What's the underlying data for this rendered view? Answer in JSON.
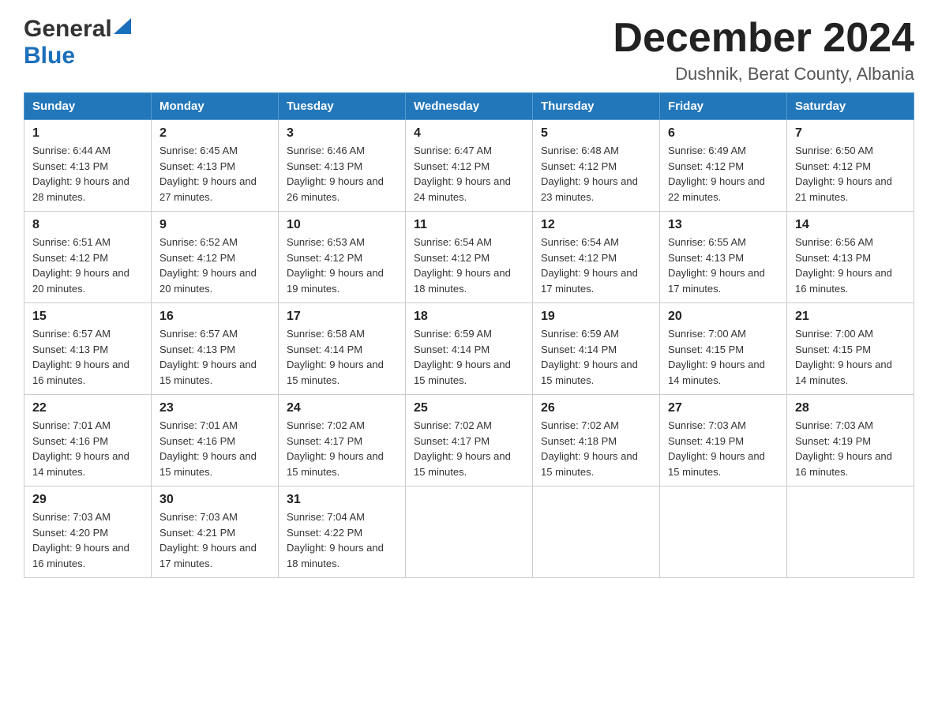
{
  "logo": {
    "general": "General",
    "blue": "Blue"
  },
  "title": {
    "month_year": "December 2024",
    "location": "Dushnik, Berat County, Albania"
  },
  "weekdays": [
    "Sunday",
    "Monday",
    "Tuesday",
    "Wednesday",
    "Thursday",
    "Friday",
    "Saturday"
  ],
  "weeks": [
    [
      {
        "day": "1",
        "sunrise": "Sunrise: 6:44 AM",
        "sunset": "Sunset: 4:13 PM",
        "daylight": "Daylight: 9 hours and 28 minutes."
      },
      {
        "day": "2",
        "sunrise": "Sunrise: 6:45 AM",
        "sunset": "Sunset: 4:13 PM",
        "daylight": "Daylight: 9 hours and 27 minutes."
      },
      {
        "day": "3",
        "sunrise": "Sunrise: 6:46 AM",
        "sunset": "Sunset: 4:13 PM",
        "daylight": "Daylight: 9 hours and 26 minutes."
      },
      {
        "day": "4",
        "sunrise": "Sunrise: 6:47 AM",
        "sunset": "Sunset: 4:12 PM",
        "daylight": "Daylight: 9 hours and 24 minutes."
      },
      {
        "day": "5",
        "sunrise": "Sunrise: 6:48 AM",
        "sunset": "Sunset: 4:12 PM",
        "daylight": "Daylight: 9 hours and 23 minutes."
      },
      {
        "day": "6",
        "sunrise": "Sunrise: 6:49 AM",
        "sunset": "Sunset: 4:12 PM",
        "daylight": "Daylight: 9 hours and 22 minutes."
      },
      {
        "day": "7",
        "sunrise": "Sunrise: 6:50 AM",
        "sunset": "Sunset: 4:12 PM",
        "daylight": "Daylight: 9 hours and 21 minutes."
      }
    ],
    [
      {
        "day": "8",
        "sunrise": "Sunrise: 6:51 AM",
        "sunset": "Sunset: 4:12 PM",
        "daylight": "Daylight: 9 hours and 20 minutes."
      },
      {
        "day": "9",
        "sunrise": "Sunrise: 6:52 AM",
        "sunset": "Sunset: 4:12 PM",
        "daylight": "Daylight: 9 hours and 20 minutes."
      },
      {
        "day": "10",
        "sunrise": "Sunrise: 6:53 AM",
        "sunset": "Sunset: 4:12 PM",
        "daylight": "Daylight: 9 hours and 19 minutes."
      },
      {
        "day": "11",
        "sunrise": "Sunrise: 6:54 AM",
        "sunset": "Sunset: 4:12 PM",
        "daylight": "Daylight: 9 hours and 18 minutes."
      },
      {
        "day": "12",
        "sunrise": "Sunrise: 6:54 AM",
        "sunset": "Sunset: 4:12 PM",
        "daylight": "Daylight: 9 hours and 17 minutes."
      },
      {
        "day": "13",
        "sunrise": "Sunrise: 6:55 AM",
        "sunset": "Sunset: 4:13 PM",
        "daylight": "Daylight: 9 hours and 17 minutes."
      },
      {
        "day": "14",
        "sunrise": "Sunrise: 6:56 AM",
        "sunset": "Sunset: 4:13 PM",
        "daylight": "Daylight: 9 hours and 16 minutes."
      }
    ],
    [
      {
        "day": "15",
        "sunrise": "Sunrise: 6:57 AM",
        "sunset": "Sunset: 4:13 PM",
        "daylight": "Daylight: 9 hours and 16 minutes."
      },
      {
        "day": "16",
        "sunrise": "Sunrise: 6:57 AM",
        "sunset": "Sunset: 4:13 PM",
        "daylight": "Daylight: 9 hours and 15 minutes."
      },
      {
        "day": "17",
        "sunrise": "Sunrise: 6:58 AM",
        "sunset": "Sunset: 4:14 PM",
        "daylight": "Daylight: 9 hours and 15 minutes."
      },
      {
        "day": "18",
        "sunrise": "Sunrise: 6:59 AM",
        "sunset": "Sunset: 4:14 PM",
        "daylight": "Daylight: 9 hours and 15 minutes."
      },
      {
        "day": "19",
        "sunrise": "Sunrise: 6:59 AM",
        "sunset": "Sunset: 4:14 PM",
        "daylight": "Daylight: 9 hours and 15 minutes."
      },
      {
        "day": "20",
        "sunrise": "Sunrise: 7:00 AM",
        "sunset": "Sunset: 4:15 PM",
        "daylight": "Daylight: 9 hours and 14 minutes."
      },
      {
        "day": "21",
        "sunrise": "Sunrise: 7:00 AM",
        "sunset": "Sunset: 4:15 PM",
        "daylight": "Daylight: 9 hours and 14 minutes."
      }
    ],
    [
      {
        "day": "22",
        "sunrise": "Sunrise: 7:01 AM",
        "sunset": "Sunset: 4:16 PM",
        "daylight": "Daylight: 9 hours and 14 minutes."
      },
      {
        "day": "23",
        "sunrise": "Sunrise: 7:01 AM",
        "sunset": "Sunset: 4:16 PM",
        "daylight": "Daylight: 9 hours and 15 minutes."
      },
      {
        "day": "24",
        "sunrise": "Sunrise: 7:02 AM",
        "sunset": "Sunset: 4:17 PM",
        "daylight": "Daylight: 9 hours and 15 minutes."
      },
      {
        "day": "25",
        "sunrise": "Sunrise: 7:02 AM",
        "sunset": "Sunset: 4:17 PM",
        "daylight": "Daylight: 9 hours and 15 minutes."
      },
      {
        "day": "26",
        "sunrise": "Sunrise: 7:02 AM",
        "sunset": "Sunset: 4:18 PM",
        "daylight": "Daylight: 9 hours and 15 minutes."
      },
      {
        "day": "27",
        "sunrise": "Sunrise: 7:03 AM",
        "sunset": "Sunset: 4:19 PM",
        "daylight": "Daylight: 9 hours and 15 minutes."
      },
      {
        "day": "28",
        "sunrise": "Sunrise: 7:03 AM",
        "sunset": "Sunset: 4:19 PM",
        "daylight": "Daylight: 9 hours and 16 minutes."
      }
    ],
    [
      {
        "day": "29",
        "sunrise": "Sunrise: 7:03 AM",
        "sunset": "Sunset: 4:20 PM",
        "daylight": "Daylight: 9 hours and 16 minutes."
      },
      {
        "day": "30",
        "sunrise": "Sunrise: 7:03 AM",
        "sunset": "Sunset: 4:21 PM",
        "daylight": "Daylight: 9 hours and 17 minutes."
      },
      {
        "day": "31",
        "sunrise": "Sunrise: 7:04 AM",
        "sunset": "Sunset: 4:22 PM",
        "daylight": "Daylight: 9 hours and 18 minutes."
      },
      null,
      null,
      null,
      null
    ]
  ],
  "colors": {
    "header_bg": "#2277bb",
    "header_text": "#ffffff",
    "border": "#cccccc",
    "logo_blue": "#1a6fba"
  }
}
